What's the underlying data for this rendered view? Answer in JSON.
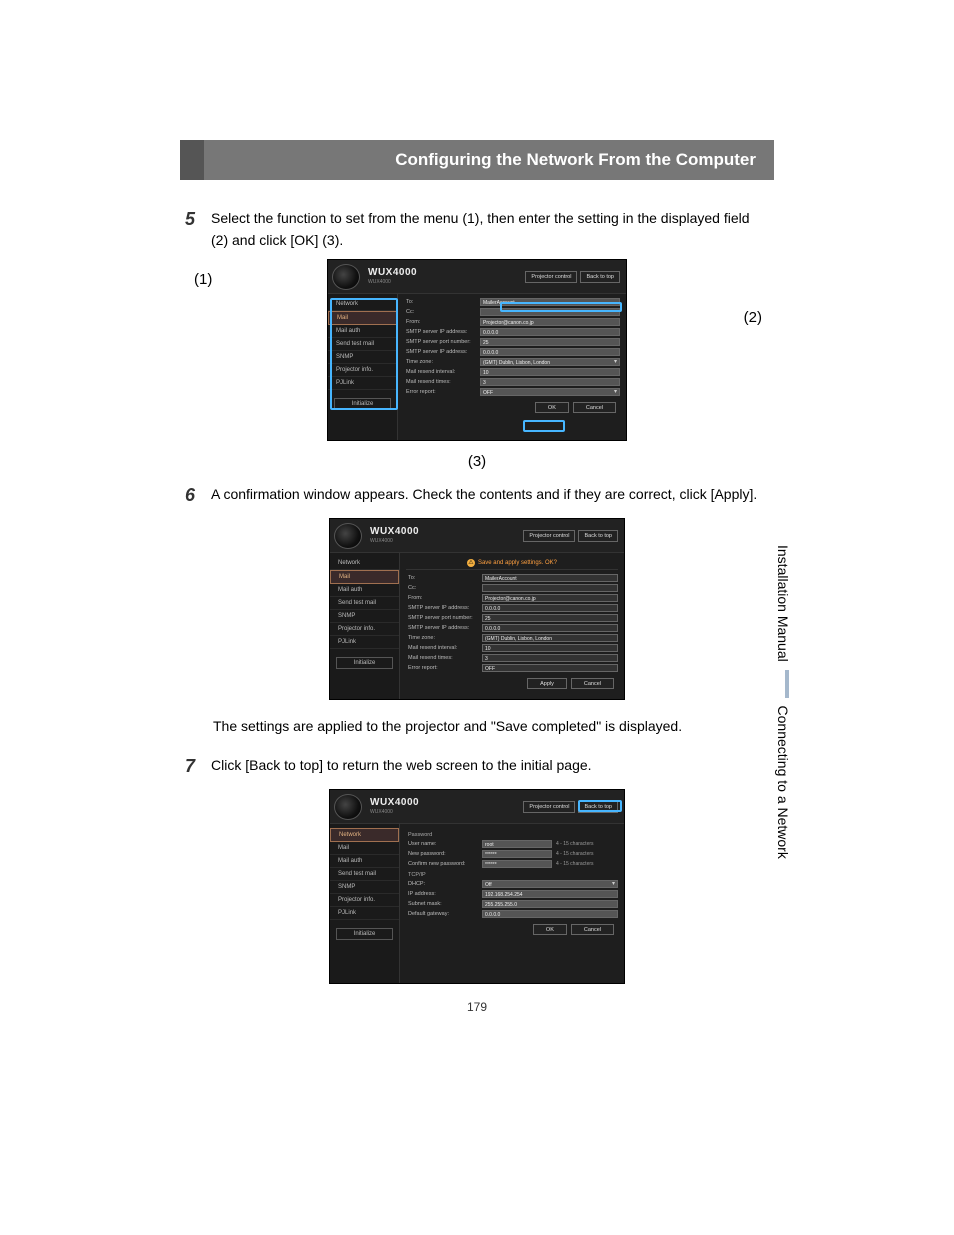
{
  "header": {
    "title": "Configuring the Network From the Computer"
  },
  "steps": {
    "s5": {
      "num": "5",
      "text": "Select the function to set from the menu (1), then enter the setting in the displayed field (2) and click [OK] (3)."
    },
    "s6": {
      "num": "6",
      "text": "A confirmation window appears. Check the contents and if they are correct, click [Apply]."
    },
    "s7": {
      "num": "7",
      "text": "Click [Back to top] to return the web screen to the initial page."
    }
  },
  "callouts": {
    "c1": "(1)",
    "c2": "(2)",
    "c3": "(3)"
  },
  "fig_common": {
    "model": "WUX4000",
    "sub": "WUX4000",
    "btn_proj": "Projector control",
    "btn_back": "Back to top",
    "side": {
      "network": "Network",
      "mail": "Mail",
      "mail_auth": "Mail auth",
      "send_test": "Send test mail",
      "snmp": "SNMP",
      "proj_info": "Projector info.",
      "pjlink": "PJLink",
      "init": "Initialize"
    }
  },
  "fig1": {
    "fields": {
      "to": "To:",
      "to_v": "MailerAccount",
      "cc": "Cc:",
      "cc_v": "",
      "from": "From:",
      "from_v": "Projector@canon.co.jp",
      "smtp_ip": "SMTP server IP address:",
      "smtp_ip_v": "0.0.0.0",
      "smtp_port": "SMTP server port number:",
      "smtp_port_v": "25",
      "smtp_ip2": "SMTP server IP address:",
      "smtp_ip2_v": "0.0.0.0",
      "tz": "Time zone:",
      "tz_v": "(GMT) Dublin, Lisbon, London",
      "interval": "Mail resend interval:",
      "interval_v": "10",
      "times": "Mail resend times:",
      "times_v": "3",
      "err": "Error report:",
      "err_v": "OFF"
    },
    "ok": "OK",
    "cancel": "Cancel"
  },
  "fig2": {
    "confirm": "Save and apply settings. OK?",
    "fields": {
      "to": "To:",
      "to_v": "MailerAccount",
      "cc": "Cc:",
      "cc_v": "",
      "from": "From:",
      "from_v": "Projector@canon.co.jp",
      "smtp_ip": "SMTP server IP address:",
      "smtp_ip_v": "0.0.0.0",
      "smtp_port": "SMTP server port number:",
      "smtp_port_v": "25",
      "smtp_ip2": "SMTP server IP address:",
      "smtp_ip2_v": "0.0.0.0",
      "tz": "Time zone:",
      "tz_v": "(GMT) Dublin, Lisbon, London",
      "interval": "Mail resend interval:",
      "interval_v": "10",
      "times": "Mail resend times:",
      "times_v": "3",
      "err": "Error report:",
      "err_v": "OFF"
    },
    "apply": "Apply",
    "cancel": "Cancel"
  },
  "fig3": {
    "sections": {
      "password": "Password",
      "tcpip": "TCP/IP"
    },
    "fields": {
      "user": "User name:",
      "user_v": "root",
      "new_pw": "New password:",
      "new_pw_v": "******",
      "conf_pw": "Confirm new password:",
      "conf_pw_v": "******",
      "note": "4 - 15 characters",
      "dhcp": "DHCP:",
      "dhcp_v": "Off",
      "ip": "IP address:",
      "ip_v": "192.168.254.254",
      "mask": "Subnet mask:",
      "mask_v": "255.255.255.0",
      "gw": "Default gateway:",
      "gw_v": "0.0.0.0"
    },
    "ok": "OK",
    "cancel": "Cancel"
  },
  "para_applied": "The settings are applied to the projector and \"Save completed\" is displayed.",
  "margin": {
    "a": "Installation Manual",
    "b": "Connecting to a Network"
  },
  "page_number": "179"
}
